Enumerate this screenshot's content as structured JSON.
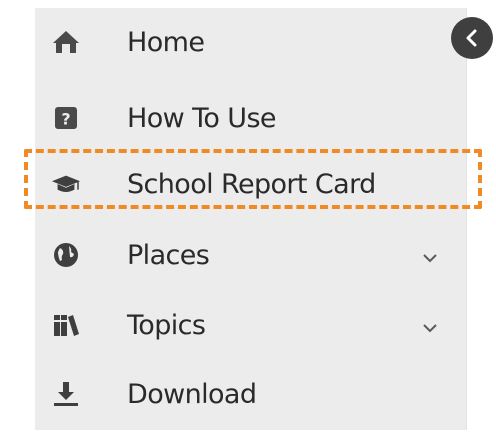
{
  "menu": {
    "items": [
      {
        "label": "Home",
        "icon": "home-icon"
      },
      {
        "label": "How To Use",
        "icon": "question-icon"
      },
      {
        "label": "School Report Card",
        "icon": "graduation-cap-icon"
      },
      {
        "label": "Places",
        "icon": "globe-icon",
        "expandable": true
      },
      {
        "label": "Topics",
        "icon": "books-icon",
        "expandable": true
      },
      {
        "label": "Download",
        "icon": "download-icon"
      }
    ]
  },
  "collapse_button": {
    "icon": "chevron-left-icon"
  },
  "colors": {
    "menu_background": "#ececec",
    "text": "#2a2a2a",
    "icon": "#3f3f3f",
    "highlight_border": "#f08a24",
    "collapse_button": "#3f3f3f"
  }
}
